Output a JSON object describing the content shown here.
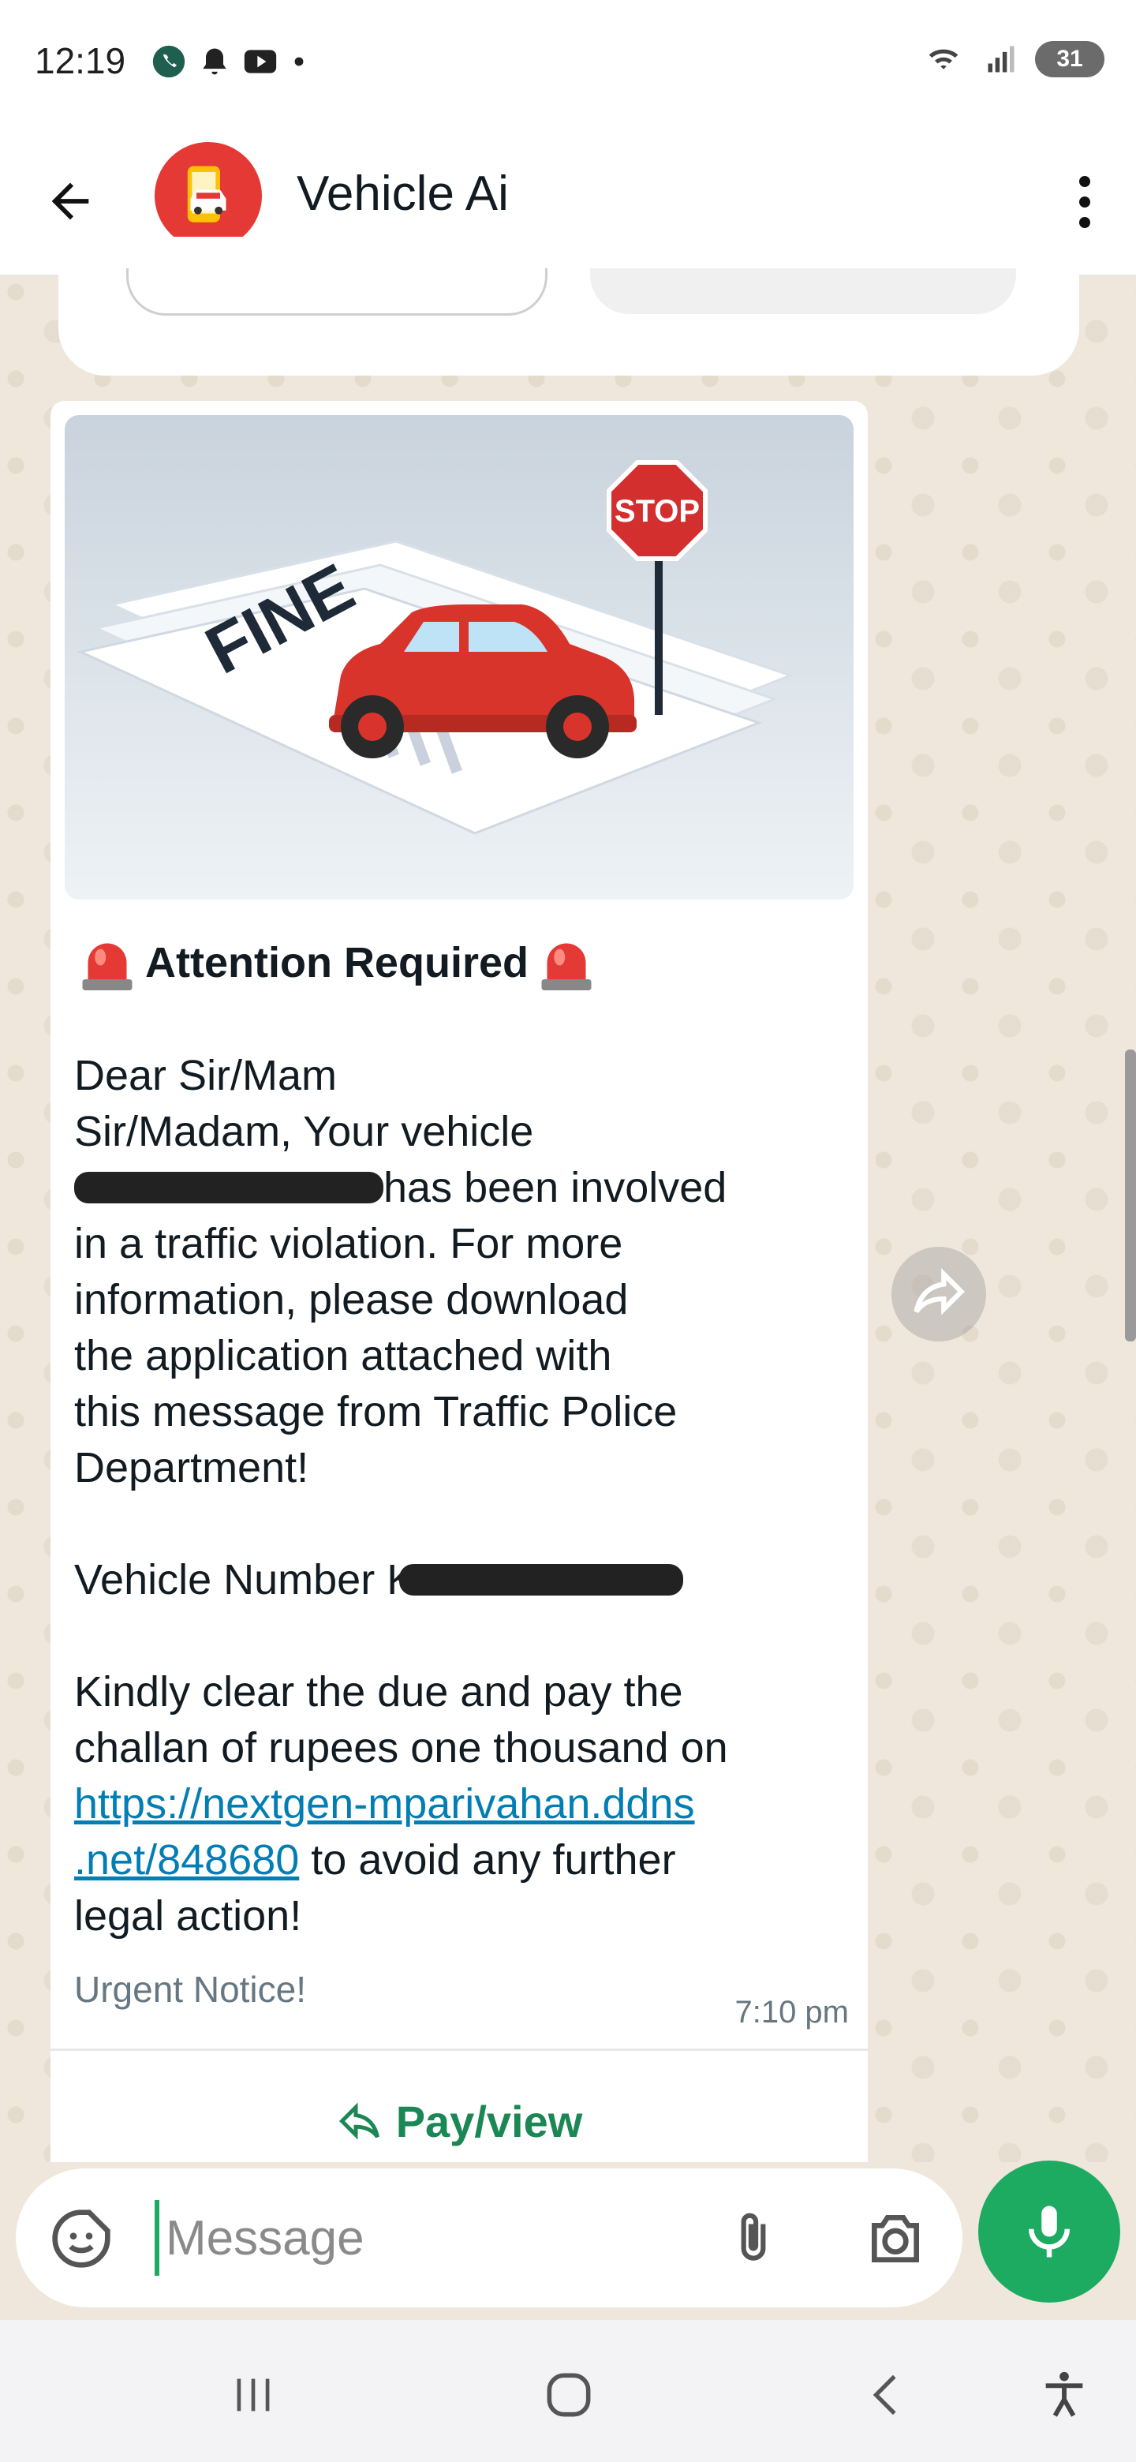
{
  "status_bar": {
    "time": "12:19",
    "battery": "31",
    "left_icons": [
      "whatsapp-call-icon",
      "bell-icon",
      "youtube-icon",
      "dot-icon"
    ],
    "right_icons": [
      "wifi-icon",
      "signal-icon",
      "battery-icon"
    ]
  },
  "header": {
    "title": "Vehicle Ai",
    "back_icon": "arrow-left-icon",
    "menu_icon": "more-vert-icon"
  },
  "message": {
    "heading": "Attention Required",
    "greeting": "Dear Sir/Mam",
    "line1": "Sir/Madam, Your vehicle",
    "line2_after_redaction": "has been involved",
    "line3": "in a traffic violation. For more",
    "line4": "information, please download",
    "line5": "the application attached with",
    "line6": "this message from Traffic Police",
    "line7": "Department!",
    "vehicle_number_label": "Vehicle Number",
    "redacted_prefix": "K",
    "pay_line1": "Kindly clear the due and pay the",
    "pay_line2": "challan of rupees one thousand on",
    "link_part1": "https://nextgen-mparivahan.ddns",
    "link_part2": ".net/848680",
    "pay_line3_after_link": "to avoid any further",
    "pay_line4": "legal action!",
    "footer": "Urgent Notice!",
    "time": "7:10 pm",
    "cta_label": "Pay/view",
    "image_text": {
      "stop": "STOP",
      "fine": "FINE"
    }
  },
  "composer": {
    "placeholder": "Message"
  },
  "colors": {
    "accent_green": "#1daa61",
    "link_blue": "#027eb5",
    "cta_green": "#1b8755",
    "wallpaper": "#efe7dc"
  }
}
